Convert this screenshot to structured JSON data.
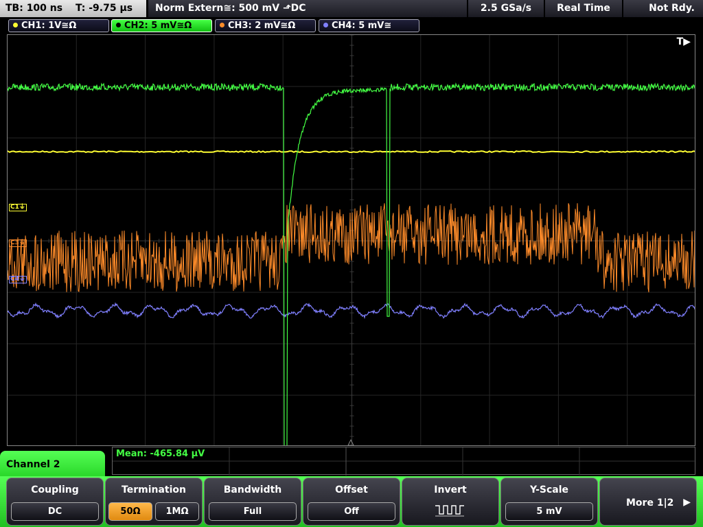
{
  "topbar": {
    "timebase": "TB: 100 ns",
    "trigger_time": "T: -9.75 µs",
    "trigger_info": "Norm   Extern≅: 500 mV ⬏DC",
    "sample_rate": "2.5 GSa/s",
    "acq_mode": "Real Time",
    "status": "Not Rdy."
  },
  "channels": [
    {
      "label": "CH1: 1V≅Ω",
      "color": "#ffff33",
      "marker": "C1⏚"
    },
    {
      "label": "CH2: 5 mV≅Ω",
      "color": "#44ff44",
      "marker": ""
    },
    {
      "label": "CH3: 2 mV≅Ω",
      "color": "#ff8c2a",
      "marker": "C3⏚"
    },
    {
      "label": "CH4: 5 mV≅",
      "color": "#8080ff",
      "marker": "C4⏚"
    }
  ],
  "screen": {
    "trigger_marker": "T▶"
  },
  "measurement": {
    "mean": "Mean: -465.84 µV"
  },
  "panel": {
    "title": "Channel 2"
  },
  "softkeys": {
    "coupling": {
      "title": "Coupling",
      "value": "DC"
    },
    "termination": {
      "title": "Termination",
      "option_a": "50Ω",
      "option_b": "1MΩ",
      "selected": "50Ω"
    },
    "bandwidth": {
      "title": "Bandwidth",
      "value": "Full"
    },
    "offset": {
      "title": "Offset",
      "value": "Off"
    },
    "invert": {
      "title": "Invert",
      "icon": "invert-pulse-icon"
    },
    "yscale": {
      "title": "Y-Scale",
      "value": "5 mV"
    },
    "more": {
      "label": "More 1|2",
      "icon": "arrow-right-icon"
    }
  }
}
